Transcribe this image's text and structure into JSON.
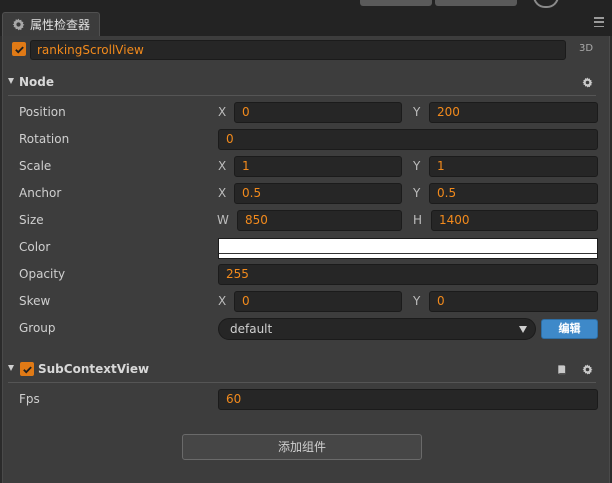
{
  "panel": {
    "tab_title": "属性检查器"
  },
  "node_header": {
    "enabled": true,
    "name": "rankingScrollView",
    "mode_badge": "3D"
  },
  "node_section": {
    "title": "Node",
    "position": {
      "label": "Position",
      "x_axis": "X",
      "x": "0",
      "y_axis": "Y",
      "y": "200"
    },
    "rotation": {
      "label": "Rotation",
      "value": "0"
    },
    "scale": {
      "label": "Scale",
      "x_axis": "X",
      "x": "1",
      "y_axis": "Y",
      "y": "1"
    },
    "anchor": {
      "label": "Anchor",
      "x_axis": "X",
      "x": "0.5",
      "y_axis": "Y",
      "y": "0.5"
    },
    "size": {
      "label": "Size",
      "w_axis": "W",
      "w": "850",
      "h_axis": "H",
      "h": "1400"
    },
    "color": {
      "label": "Color",
      "value": "#ffffff"
    },
    "opacity": {
      "label": "Opacity",
      "value": "255"
    },
    "skew": {
      "label": "Skew",
      "x_axis": "X",
      "x": "0",
      "y_axis": "Y",
      "y": "0"
    },
    "group": {
      "label": "Group",
      "value": "default",
      "edit_label": "编辑"
    }
  },
  "component_section": {
    "title": "SubContextView",
    "enabled": true,
    "fps": {
      "label": "Fps",
      "value": "60"
    }
  },
  "add_component": {
    "label": "添加组件"
  },
  "colors": {
    "accent": "#f28a1c",
    "checkbox": "#e07a16",
    "button_blue": "#3e89c9",
    "panel_bg": "#3d3d3d",
    "field_bg": "#262626"
  },
  "icons": [
    "gear-icon",
    "menu-icon",
    "checkmark-icon",
    "collapse-arrow-icon",
    "book-icon",
    "refresh-icon"
  ]
}
